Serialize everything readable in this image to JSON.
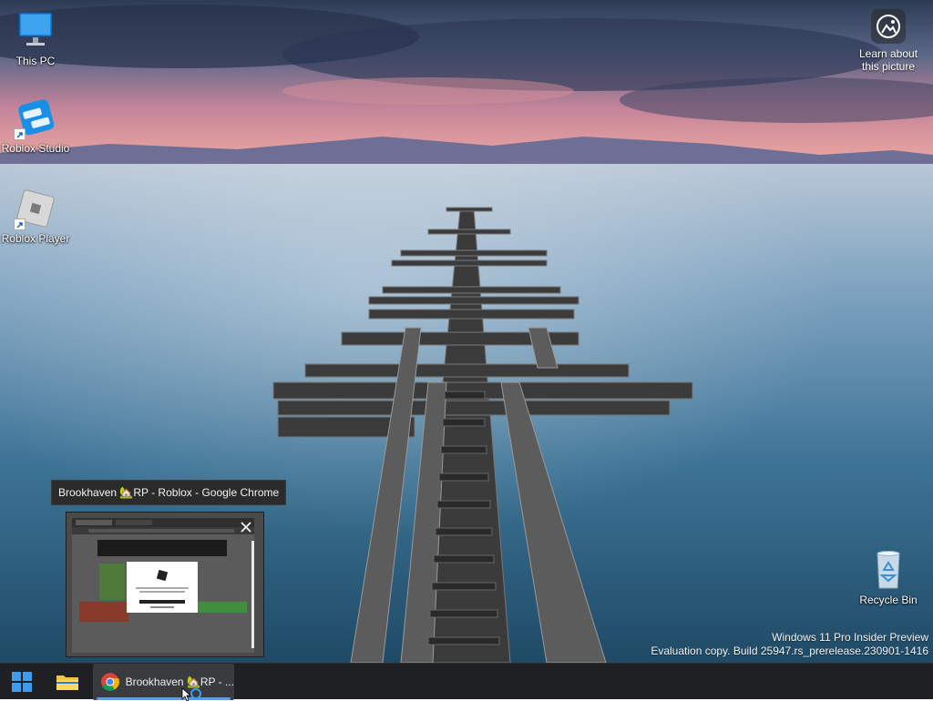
{
  "desktop": {
    "icons": [
      {
        "label": "This PC"
      },
      {
        "label": "Roblox Studio"
      },
      {
        "label": "Roblox Player"
      },
      {
        "label": "Recycle Bin"
      }
    ],
    "learn_picture_label": "Learn about this picture"
  },
  "watermark": {
    "line1": "Windows 11 Pro Insider Preview",
    "line2": "Evaluation copy. Build 25947.rs_prerelease.230901-1416"
  },
  "preview": {
    "tooltip": "Brookhaven 🏡RP - Roblox - Google Chrome"
  },
  "taskbar": {
    "start_icon": "windows-logo-icon",
    "explorer_icon": "file-explorer-icon",
    "chrome_title": "Brookhaven 🏡RP - ...",
    "accent": "#5aa0e6"
  },
  "colors": {
    "taskbar_bg": "#1f2023",
    "active_app_bg": "#3a3b3e"
  }
}
